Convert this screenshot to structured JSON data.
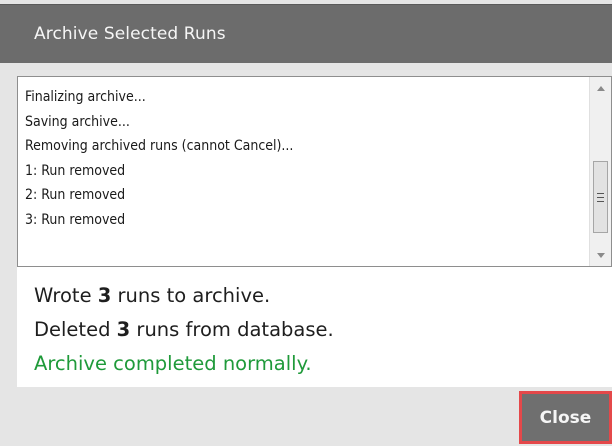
{
  "dialog": {
    "title": "Archive Selected Runs"
  },
  "log": {
    "lines": [
      "Finalizing archive...",
      "Saving archive...",
      "Removing archived runs (cannot Cancel)...",
      "1: Run removed",
      "2: Run removed",
      "3: Run removed"
    ],
    "scrollbar": {
      "up_icon": "scroll-up-arrow",
      "down_icon": "scroll-down-arrow",
      "thumb_icon": "grip-lines"
    }
  },
  "summary": {
    "wrote_prefix": "Wrote ",
    "wrote_count": "3",
    "wrote_suffix": " runs to archive.",
    "deleted_prefix": "Deleted ",
    "deleted_count": "3",
    "deleted_suffix": " runs from database.",
    "status": "Archive completed normally.",
    "status_color": "#1f9a3a"
  },
  "buttons": {
    "close_label": "Close",
    "close_highlight_color": "#e4484a"
  }
}
